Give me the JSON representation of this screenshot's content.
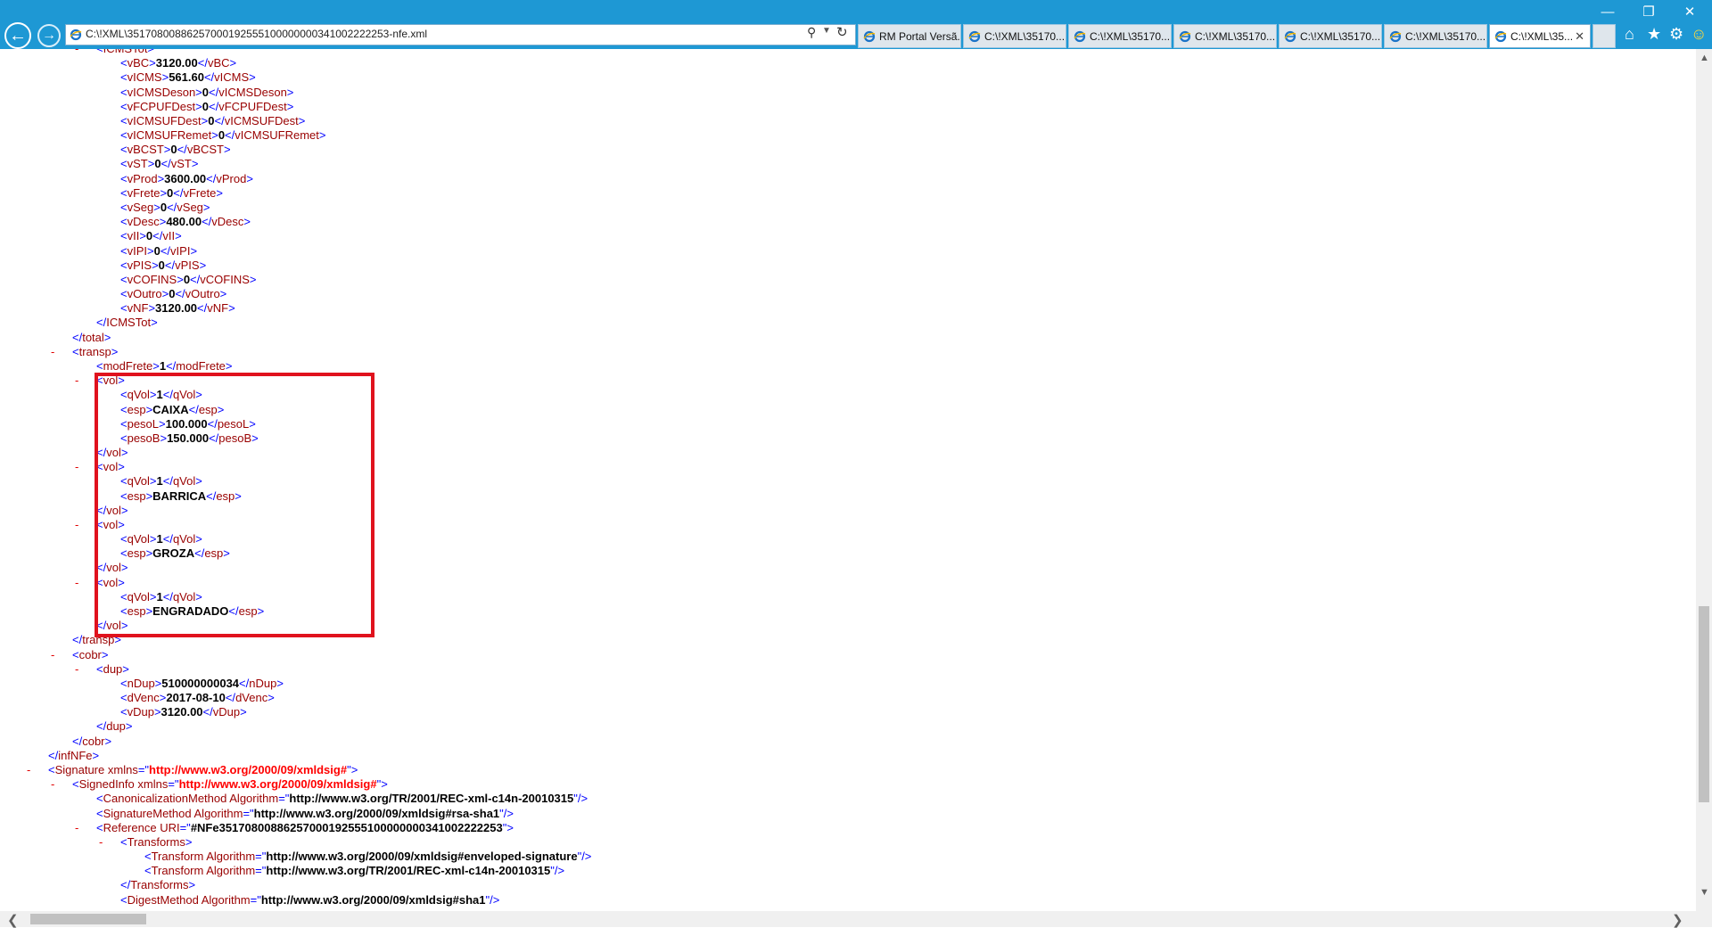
{
  "browser": {
    "address": "C:\\!XML\\35170800886257000192555100000000341002222253-nfe.xml",
    "tabs": [
      {
        "label": "RM Portal Versã..."
      },
      {
        "label": "C:\\!XML\\35170..."
      },
      {
        "label": "C:\\!XML\\35170..."
      },
      {
        "label": "C:\\!XML\\35170..."
      },
      {
        "label": "C:\\!XML\\35170..."
      },
      {
        "label": "C:\\!XML\\35170..."
      },
      {
        "label": "C:\\!XML\\35..."
      }
    ],
    "icons": [
      "back-arrow",
      "forward-arrow",
      "search",
      "refresh",
      "home",
      "favorites-star",
      "settings-gear",
      "smiley-feedback",
      "minimize",
      "restore",
      "close"
    ],
    "colors": {
      "caption": "#1e98d4",
      "tag": "#990000",
      "bracket": "#0000ff",
      "dash": "#e00000",
      "highlight": "#e0121d"
    }
  },
  "xml": {
    "lines": [
      {
        "dash": "-",
        "open": "ICMSTot"
      },
      {
        "open": "vBC",
        "text": "3120.00",
        "close": "vBC"
      },
      {
        "open": "vICMS",
        "text": "561.60",
        "close": "vICMS"
      },
      {
        "open": "vICMSDeson",
        "text": "0",
        "close": "vICMSDeson"
      },
      {
        "open": "vFCPUFDest",
        "text": "0",
        "close": "vFCPUFDest"
      },
      {
        "open": "vICMSUFDest",
        "text": "0",
        "close": "vICMSUFDest"
      },
      {
        "open": "vICMSUFRemet",
        "text": "0",
        "close": "vICMSUFRemet"
      },
      {
        "open": "vBCST",
        "text": "0",
        "close": "vBCST"
      },
      {
        "open": "vST",
        "text": "0",
        "close": "vST"
      },
      {
        "open": "vProd",
        "text": "3600.00",
        "close": "vProd"
      },
      {
        "open": "vFrete",
        "text": "0",
        "close": "vFrete"
      },
      {
        "open": "vSeg",
        "text": "0",
        "close": "vSeg"
      },
      {
        "open": "vDesc",
        "text": "480.00",
        "close": "vDesc"
      },
      {
        "open": "vII",
        "text": "0",
        "close": "vII"
      },
      {
        "open": "vIPI",
        "text": "0",
        "close": "vIPI"
      },
      {
        "open": "vPIS",
        "text": "0",
        "close": "vPIS"
      },
      {
        "open": "vCOFINS",
        "text": "0",
        "close": "vCOFINS"
      },
      {
        "open": "vOutro",
        "text": "0",
        "close": "vOutro"
      },
      {
        "open": "vNF",
        "text": "3120.00",
        "close": "vNF"
      },
      {
        "close": "ICMSTot"
      },
      {
        "close": "total"
      },
      {
        "dash": "-",
        "open": "transp"
      },
      {
        "open": "modFrete",
        "text": "1",
        "close": "modFrete"
      },
      {
        "dash": "-",
        "open": "vol"
      },
      {
        "open": "qVol",
        "text": "1",
        "close": "qVol"
      },
      {
        "open": "esp",
        "text": "CAIXA",
        "close": "esp"
      },
      {
        "open": "pesoL",
        "text": "100.000",
        "close": "pesoL"
      },
      {
        "open": "pesoB",
        "text": "150.000",
        "close": "pesoB"
      },
      {
        "close": "vol"
      },
      {
        "dash": "-",
        "open": "vol"
      },
      {
        "open": "qVol",
        "text": "1",
        "close": "qVol"
      },
      {
        "open": "esp",
        "text": "BARRICA",
        "close": "esp"
      },
      {
        "close": "vol"
      },
      {
        "dash": "-",
        "open": "vol"
      },
      {
        "open": "qVol",
        "text": "1",
        "close": "qVol"
      },
      {
        "open": "esp",
        "text": "GROZA",
        "close": "esp"
      },
      {
        "close": "vol"
      },
      {
        "dash": "-",
        "open": "vol"
      },
      {
        "open": "qVol",
        "text": "1",
        "close": "qVol"
      },
      {
        "open": "esp",
        "text": "ENGRADADO",
        "close": "esp"
      },
      {
        "close": "vol"
      },
      {
        "close": "transp"
      },
      {
        "dash": "-",
        "open": "cobr"
      },
      {
        "dash": "-",
        "open": "dup"
      },
      {
        "open": "nDup",
        "text": "510000000034",
        "close": "nDup"
      },
      {
        "open": "dVenc",
        "text": "2017-08-10",
        "close": "dVenc"
      },
      {
        "open": "vDup",
        "text": "3120.00",
        "close": "vDup"
      },
      {
        "close": "dup"
      },
      {
        "close": "cobr"
      },
      {
        "close": "infNFe"
      },
      {
        "dash": "-",
        "open": "Signature",
        "attr": "xmlns",
        "val": "http://www.w3.org/2000/09/xmldsig#",
        "nsval": true
      },
      {
        "dash": "-",
        "open": "SignedInfo",
        "attr": "xmlns",
        "val": "http://www.w3.org/2000/09/xmldsig#",
        "nsval": true
      },
      {
        "open": "CanonicalizationMethod",
        "attr": "Algorithm",
        "val": "http://www.w3.org/TR/2001/REC-xml-c14n-20010315",
        "selfclose": true
      },
      {
        "open": "SignatureMethod",
        "attr": "Algorithm",
        "val": "http://www.w3.org/2000/09/xmldsig#rsa-sha1",
        "selfclose": true
      },
      {
        "dash": "-",
        "open": "Reference",
        "attr": "URI",
        "val": "#NFe35170800886257000192555100000000341002222253"
      },
      {
        "dash": "-",
        "open": "Transforms"
      },
      {
        "open": "Transform",
        "attr": "Algorithm",
        "val": "http://www.w3.org/2000/09/xmldsig#enveloped-signature",
        "selfclose": true
      },
      {
        "open": "Transform",
        "attr": "Algorithm",
        "val": "http://www.w3.org/TR/2001/REC-xml-c14n-20010315",
        "selfclose": true
      },
      {
        "close": "Transforms"
      },
      {
        "open": "DigestMethod",
        "attr": "Algorithm",
        "val": "http://www.w3.org/2000/09/xmldsig#sha1",
        "selfclose": true
      }
    ]
  }
}
